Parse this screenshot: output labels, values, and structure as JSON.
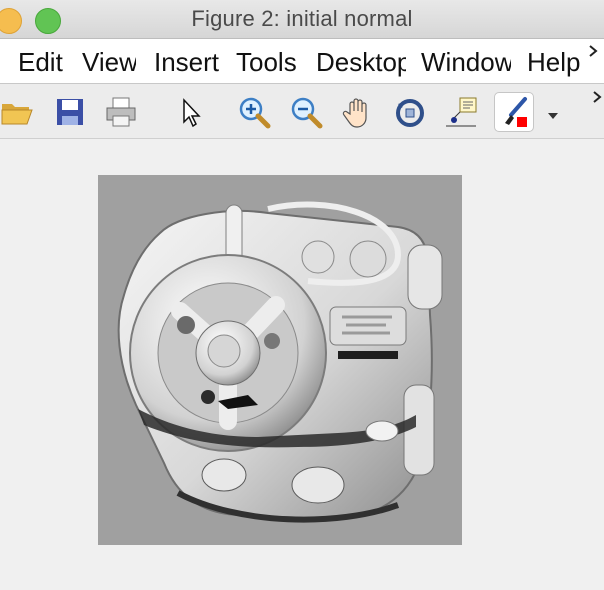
{
  "window": {
    "title": "Figure 2: initial normal"
  },
  "menu": {
    "items": [
      "Edit",
      "View",
      "Insert",
      "Tools",
      "Desktop",
      "Window",
      "Help"
    ],
    "overflow_icon": "chevron-right-icon"
  },
  "toolbar": {
    "buttons": [
      {
        "name": "open-file-button",
        "icon": "folder-open-icon"
      },
      {
        "name": "save-button",
        "icon": "floppy-disk-icon"
      },
      {
        "name": "print-button",
        "icon": "printer-icon"
      },
      {
        "name": "select-pointer-button",
        "icon": "arrow-pointer-icon"
      },
      {
        "name": "zoom-in-button",
        "icon": "zoom-in-icon"
      },
      {
        "name": "zoom-out-button",
        "icon": "zoom-out-icon"
      },
      {
        "name": "pan-button",
        "icon": "hand-icon"
      },
      {
        "name": "rotate-3d-button",
        "icon": "rotate-3d-icon"
      },
      {
        "name": "data-cursor-button",
        "icon": "data-tip-icon"
      },
      {
        "name": "brush-button",
        "icon": "brush-icon",
        "active": true
      }
    ],
    "brush_color": "#ff0000"
  },
  "image": {
    "subject": "grayscale normal-map shading of a toy car with steering wheel"
  }
}
